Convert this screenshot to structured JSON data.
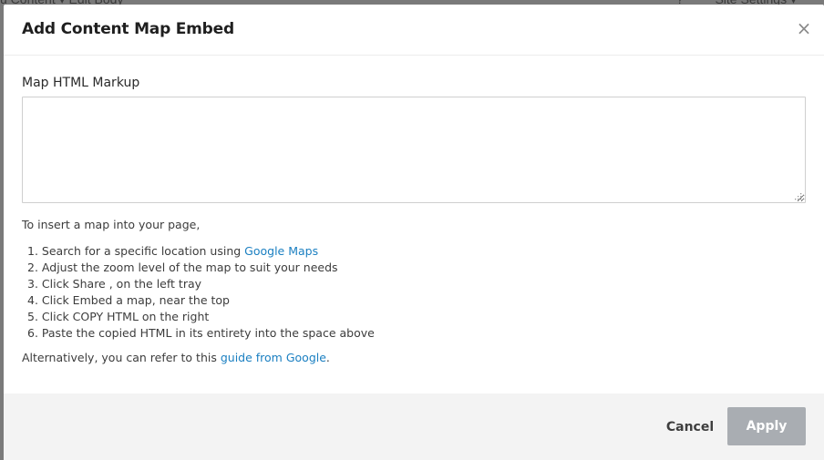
{
  "background": {
    "nav_left": "u Content ▾   Edit Body",
    "nav_help": "?",
    "nav_right": "Site Settings ▾"
  },
  "modal": {
    "title": "Add Content Map Embed",
    "close_icon": "×",
    "field_label": "Map HTML Markup",
    "textarea_value": "",
    "intro": "To insert a map into your page,",
    "steps": [
      {
        "num": "1.",
        "text": "Search for a specific location using ",
        "link": "Google Maps"
      },
      {
        "num": "2.",
        "text": "Adjust the zoom level of the map to suit your needs"
      },
      {
        "num": "3.",
        "text": "Click Share , on the left tray"
      },
      {
        "num": "4.",
        "text": "Click Embed a map, near the top"
      },
      {
        "num": "5.",
        "text": "Click COPY HTML on the right"
      },
      {
        "num": "6.",
        "text": "Paste the copied HTML in its entirety into the space above"
      }
    ],
    "alt_prefix": "Alternatively, you can refer to this ",
    "alt_link": "guide from Google",
    "alt_suffix": "."
  },
  "footer": {
    "cancel_label": "Cancel",
    "apply_label": "Apply"
  },
  "colors": {
    "link": "#1a7fc1",
    "apply_disabled": "#a9adb2",
    "footer_bg": "#f3f3f3",
    "backdrop": "#7a7a7a"
  }
}
